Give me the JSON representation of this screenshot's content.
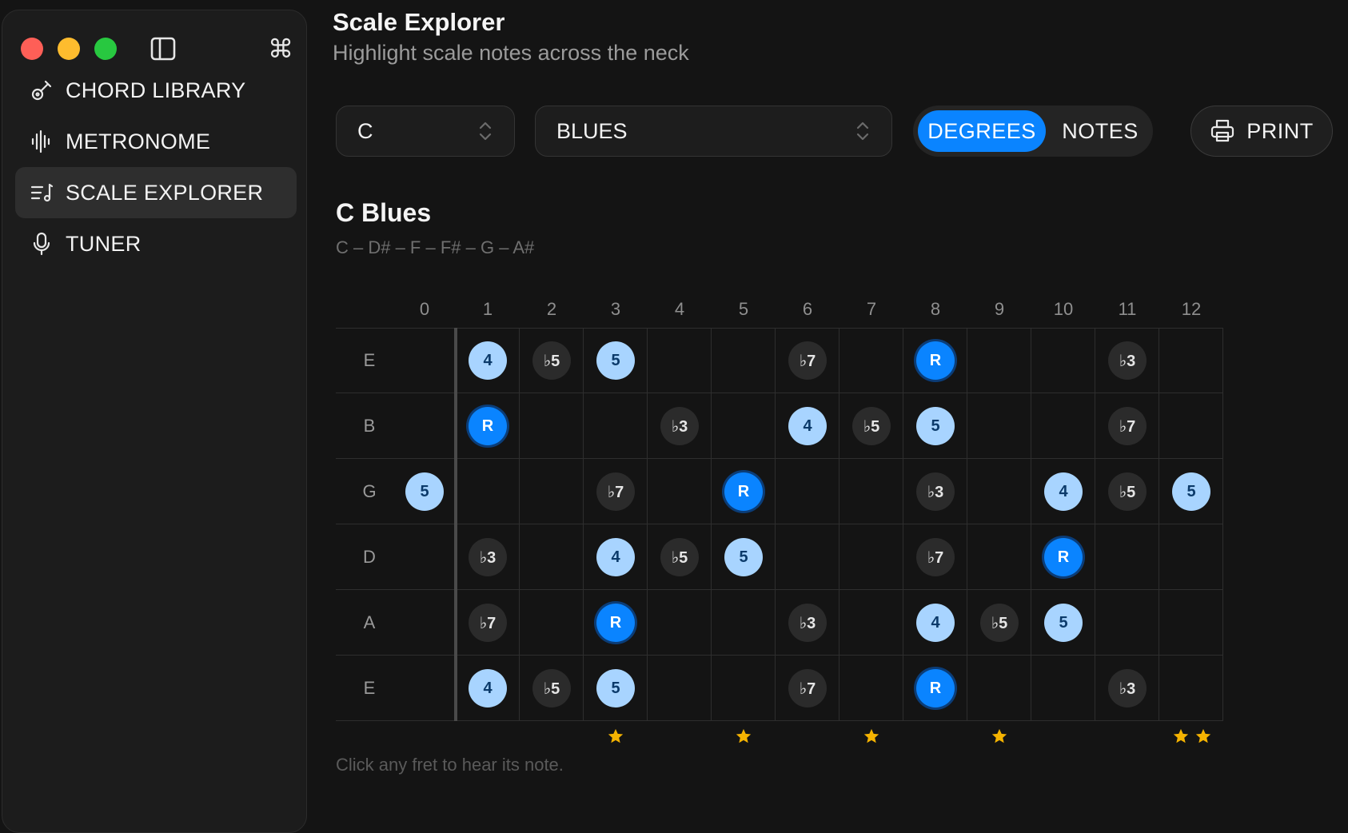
{
  "sidebar": {
    "items": [
      {
        "label": "CHORD LIBRARY",
        "icon": "guitar-icon",
        "active": false
      },
      {
        "label": "METRONOME",
        "icon": "waveform-icon",
        "active": false
      },
      {
        "label": "SCALE EXPLORER",
        "icon": "music-list-icon",
        "active": true
      },
      {
        "label": "TUNER",
        "icon": "microphone-icon",
        "active": false
      }
    ]
  },
  "header": {
    "title": "Scale Explorer",
    "subtitle": "Highlight scale notes across the neck"
  },
  "controls": {
    "key_value": "C",
    "scale_value": "BLUES",
    "mode_options": [
      "DEGREES",
      "NOTES"
    ],
    "mode_selected": "DEGREES",
    "print_label": "PRINT"
  },
  "scale": {
    "name": "C Blues",
    "notes": "C – D# – F – F# – G – A#"
  },
  "fretboard": {
    "fret_numbers": [
      "0",
      "1",
      "2",
      "3",
      "4",
      "5",
      "6",
      "7",
      "8",
      "9",
      "10",
      "11",
      "12"
    ],
    "marker_frets": [
      3,
      5,
      7,
      9
    ],
    "double_marker_fret": 12,
    "strings": [
      {
        "label": "E",
        "notes": [
          {
            "fret": 1,
            "degree": "4",
            "kind": "chord"
          },
          {
            "fret": 2,
            "degree": "♭5",
            "kind": "passing"
          },
          {
            "fret": 3,
            "degree": "5",
            "kind": "chord"
          },
          {
            "fret": 6,
            "degree": "♭7",
            "kind": "passing"
          },
          {
            "fret": 8,
            "degree": "R",
            "kind": "root"
          },
          {
            "fret": 11,
            "degree": "♭3",
            "kind": "passing"
          }
        ]
      },
      {
        "label": "B",
        "notes": [
          {
            "fret": 1,
            "degree": "R",
            "kind": "root"
          },
          {
            "fret": 4,
            "degree": "♭3",
            "kind": "passing"
          },
          {
            "fret": 6,
            "degree": "4",
            "kind": "chord"
          },
          {
            "fret": 7,
            "degree": "♭5",
            "kind": "passing"
          },
          {
            "fret": 8,
            "degree": "5",
            "kind": "chord"
          },
          {
            "fret": 11,
            "degree": "♭7",
            "kind": "passing"
          }
        ]
      },
      {
        "label": "G",
        "notes": [
          {
            "fret": 0,
            "degree": "5",
            "kind": "chord"
          },
          {
            "fret": 3,
            "degree": "♭7",
            "kind": "passing"
          },
          {
            "fret": 5,
            "degree": "R",
            "kind": "root"
          },
          {
            "fret": 8,
            "degree": "♭3",
            "kind": "passing"
          },
          {
            "fret": 10,
            "degree": "4",
            "kind": "chord"
          },
          {
            "fret": 11,
            "degree": "♭5",
            "kind": "passing"
          },
          {
            "fret": 12,
            "degree": "5",
            "kind": "chord"
          }
        ]
      },
      {
        "label": "D",
        "notes": [
          {
            "fret": 1,
            "degree": "♭3",
            "kind": "passing"
          },
          {
            "fret": 3,
            "degree": "4",
            "kind": "chord"
          },
          {
            "fret": 4,
            "degree": "♭5",
            "kind": "passing"
          },
          {
            "fret": 5,
            "degree": "5",
            "kind": "chord"
          },
          {
            "fret": 8,
            "degree": "♭7",
            "kind": "passing"
          },
          {
            "fret": 10,
            "degree": "R",
            "kind": "root"
          }
        ]
      },
      {
        "label": "A",
        "notes": [
          {
            "fret": 1,
            "degree": "♭7",
            "kind": "passing"
          },
          {
            "fret": 3,
            "degree": "R",
            "kind": "root"
          },
          {
            "fret": 6,
            "degree": "♭3",
            "kind": "passing"
          },
          {
            "fret": 8,
            "degree": "4",
            "kind": "chord"
          },
          {
            "fret": 9,
            "degree": "♭5",
            "kind": "passing"
          },
          {
            "fret": 10,
            "degree": "5",
            "kind": "chord"
          }
        ]
      },
      {
        "label": "E",
        "notes": [
          {
            "fret": 1,
            "degree": "4",
            "kind": "chord"
          },
          {
            "fret": 2,
            "degree": "♭5",
            "kind": "passing"
          },
          {
            "fret": 3,
            "degree": "5",
            "kind": "chord"
          },
          {
            "fret": 6,
            "degree": "♭7",
            "kind": "passing"
          },
          {
            "fret": 8,
            "degree": "R",
            "kind": "root"
          },
          {
            "fret": 11,
            "degree": "♭3",
            "kind": "passing"
          }
        ]
      }
    ]
  },
  "hint": "Click any fret to hear its note.",
  "colors": {
    "root": "#0a84ff",
    "chord_tone": "#a8d4ff",
    "passing_tone": "#2b2b2b",
    "marker": "#f5b301"
  }
}
